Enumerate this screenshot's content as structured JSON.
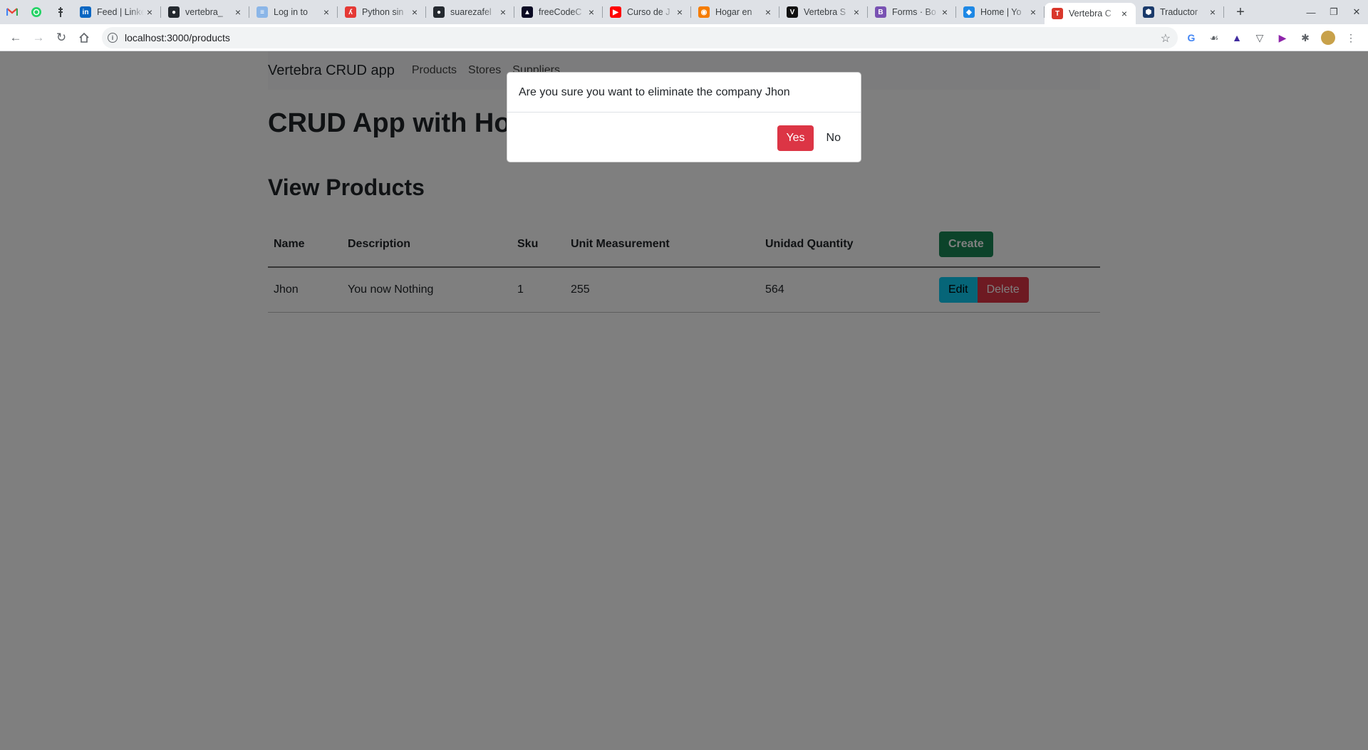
{
  "browser": {
    "pinned_tabs": [
      {
        "icon": "gmail-icon",
        "color": "#ea4335"
      },
      {
        "icon": "whatsapp-icon",
        "color": "#25d366"
      },
      {
        "icon": "bitwarden-icon",
        "color": "#3c4043"
      }
    ],
    "tabs": [
      {
        "title": "Feed | LinkedIn",
        "icon": "linkedin-icon",
        "color": "#0a66c2",
        "glyph": "in"
      },
      {
        "title": "vertebra_",
        "icon": "github-icon",
        "color": "#24292f",
        "glyph": "●"
      },
      {
        "title": "Log in to",
        "icon": "trello-icon",
        "color": "#8bb6e8",
        "glyph": "≡"
      },
      {
        "title": "Python sin",
        "icon": "python-site-icon",
        "color": "#e53935",
        "glyph": "ʎ"
      },
      {
        "title": "suarezafel",
        "icon": "github-icon",
        "color": "#24292f",
        "glyph": "●"
      },
      {
        "title": "freeCodeC",
        "icon": "freecodecamp-icon",
        "color": "#0a0a23",
        "glyph": "▲"
      },
      {
        "title": "Curso de J",
        "icon": "youtube-icon",
        "color": "#ff0000",
        "glyph": "▶"
      },
      {
        "title": "Hogar en",
        "icon": "home-store-icon",
        "color": "#f57c00",
        "glyph": "◉"
      },
      {
        "title": "Vertebra S",
        "icon": "vertebra-icon",
        "color": "#111111",
        "glyph": "V"
      },
      {
        "title": "Forms · Bo",
        "icon": "bootstrap-icon",
        "color": "#7952b3",
        "glyph": "B"
      },
      {
        "title": "Home | Yo",
        "icon": "home-site-icon",
        "color": "#1e88e5",
        "glyph": "◆"
      },
      {
        "title": "Vertebra C",
        "icon": "react-app-icon",
        "color": "#d9372b",
        "glyph": "T",
        "active": true
      },
      {
        "title": "Traductor",
        "icon": "translator-icon",
        "color": "#1a3a6b",
        "glyph": "⬢"
      }
    ],
    "url": "localhost:3000/products"
  },
  "app": {
    "brand": "Vertebra CRUD app",
    "nav": [
      "Products",
      "Stores",
      "Suppliers"
    ],
    "page_title": "CRUD App with Hooks",
    "section_title": "View Products",
    "table": {
      "headers": [
        "Name",
        "Description",
        "Sku",
        "Unit Measurement",
        "Unidad Quantity"
      ],
      "create_label": "Create",
      "rows": [
        {
          "name": "Jhon",
          "description": "You now Nothing",
          "sku": "1",
          "unit": "255",
          "quantity": "564"
        }
      ],
      "edit_label": "Edit",
      "delete_label": "Delete"
    }
  },
  "modal": {
    "message": "Are you sure you want to eliminate the company Jhon",
    "yes_label": "Yes",
    "no_label": "No"
  }
}
